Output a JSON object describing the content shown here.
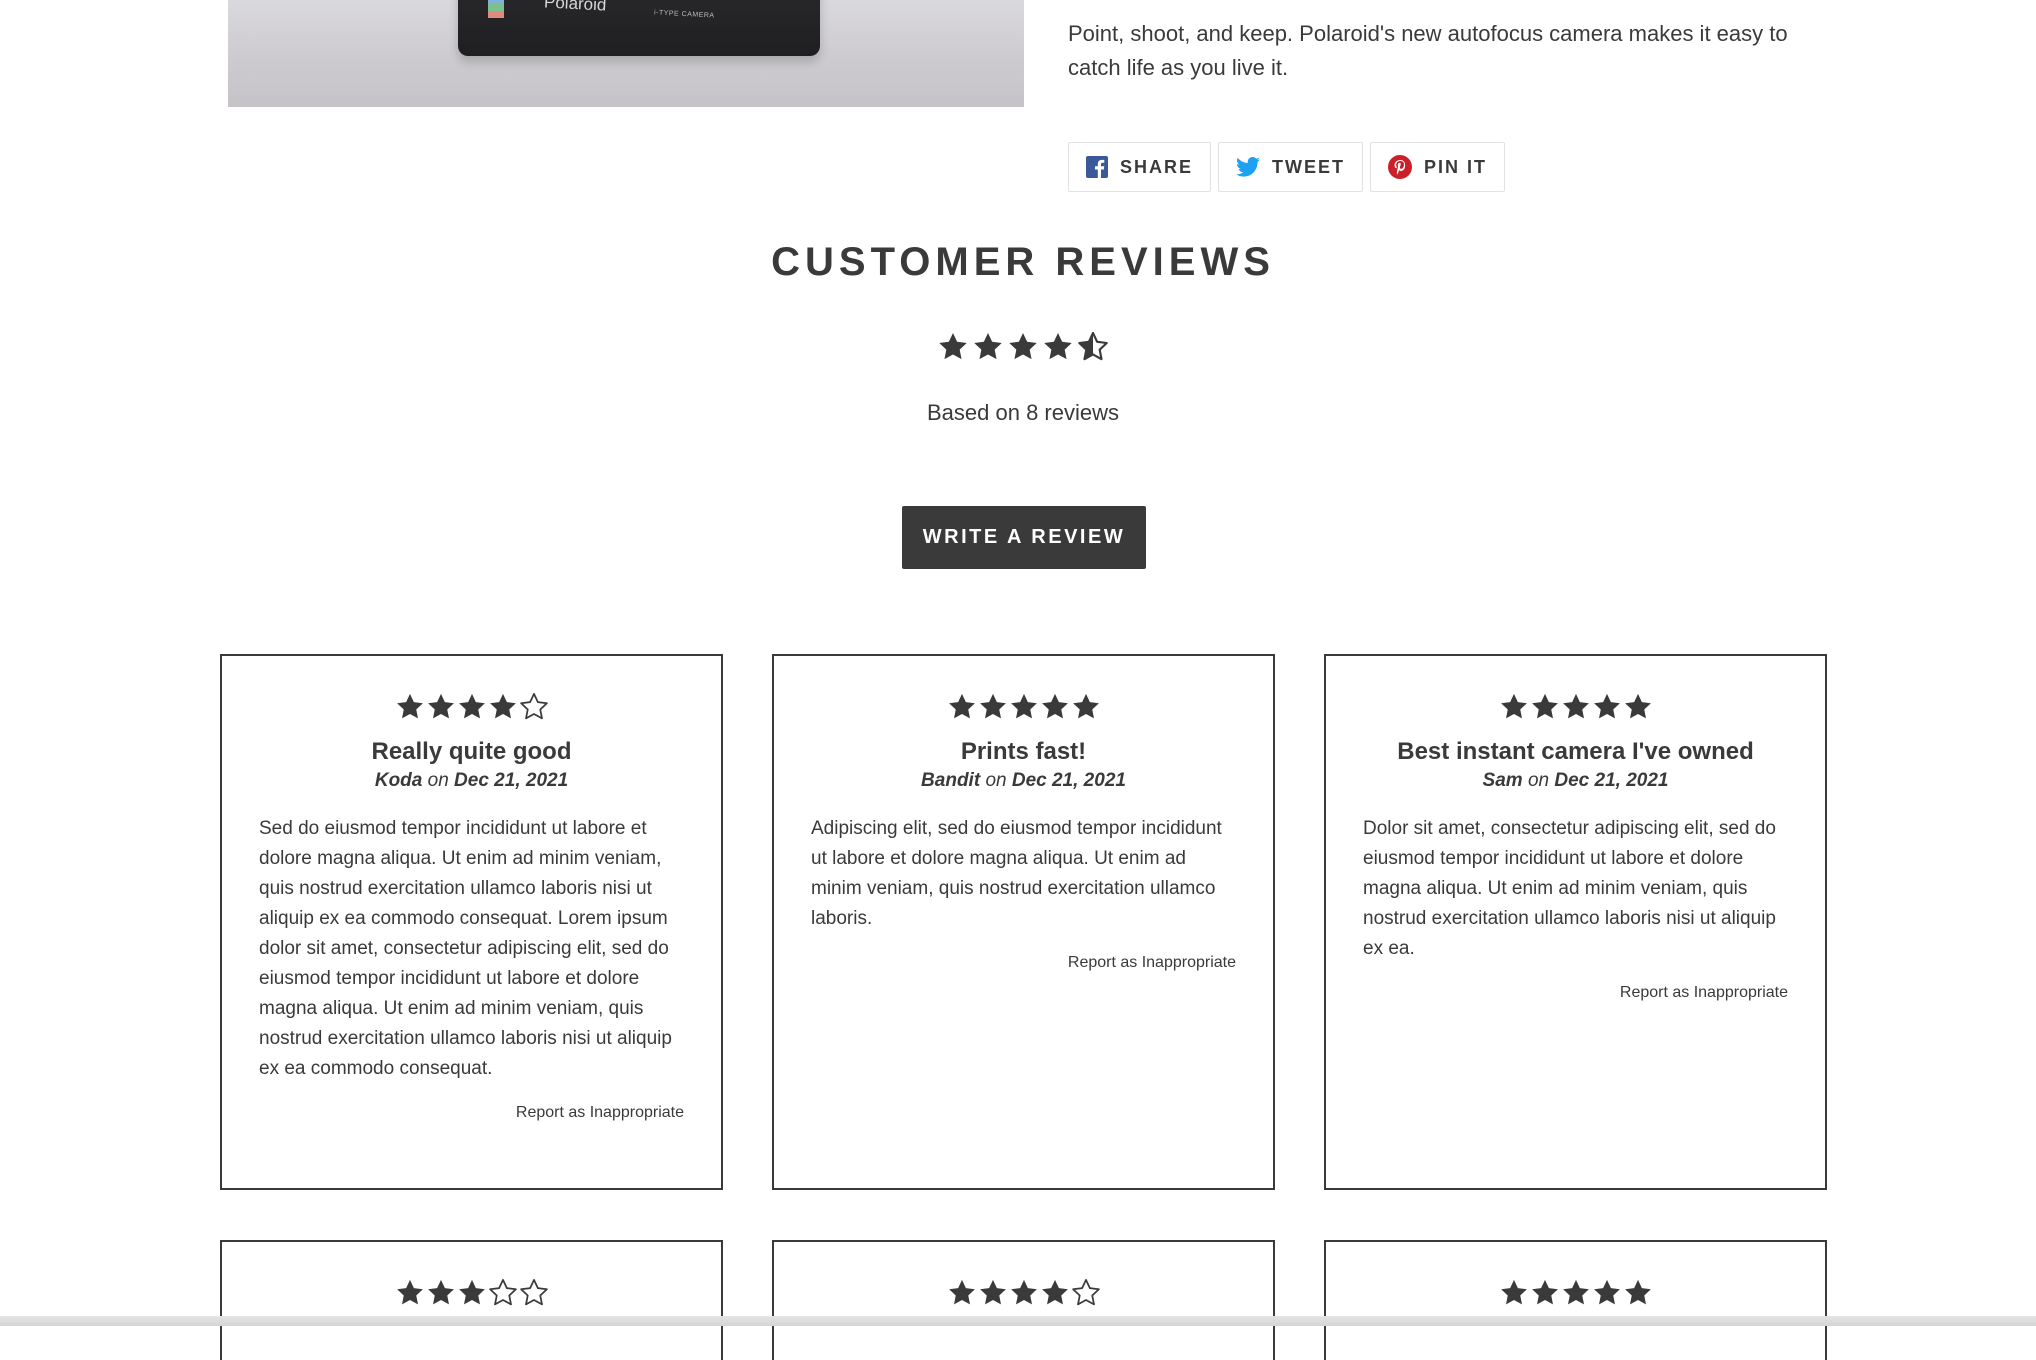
{
  "product": {
    "image_alt": "Polaroid camera",
    "camera_brand_text": "Polaroid",
    "camera_model_text": "i-TYPE CAMERA",
    "description": "Point, shoot, and keep. Polaroid's new autofocus camera makes it easy to catch life as you live it."
  },
  "share": {
    "facebook_label": "SHARE",
    "twitter_label": "TWEET",
    "pinterest_label": "PIN IT",
    "facebook_color": "#3b5998",
    "twitter_color": "#1da1f2",
    "pinterest_color": "#cb2027"
  },
  "reviews_section": {
    "title": "CUSTOMER REVIEWS",
    "average_rating": 4.5,
    "max_rating": 5,
    "summary": "Based on 8 reviews",
    "write_review_label": "WRITE A REVIEW"
  },
  "reviews": [
    {
      "rating": 4,
      "title": "Really quite good",
      "author": "Koda",
      "on": "on",
      "date": "Dec 21, 2021",
      "body": "Sed do eiusmod tempor incididunt ut labore et dolore magna aliqua. Ut enim ad minim veniam, quis nostrud exercitation ullamco laboris nisi ut aliquip ex ea commodo consequat. Lorem ipsum dolor sit amet, consectetur adipiscing elit, sed do eiusmod tempor incididunt ut labore et dolore magna aliqua. Ut enim ad minim veniam, quis nostrud exercitation ullamco laboris nisi ut aliquip ex ea commodo consequat.",
      "report_label": "Report as Inappropriate"
    },
    {
      "rating": 5,
      "title": "Prints fast!",
      "author": "Bandit",
      "on": "on",
      "date": "Dec 21, 2021",
      "body": "Adipiscing elit, sed do eiusmod tempor incididunt ut labore et dolore magna aliqua. Ut enim ad minim veniam, quis nostrud exercitation ullamco laboris.",
      "report_label": "Report as Inappropriate"
    },
    {
      "rating": 5,
      "title": "Best instant camera I've owned",
      "author": "Sam",
      "on": "on",
      "date": "Dec 21, 2021",
      "body": "Dolor sit amet, consectetur adipiscing elit, sed do eiusmod tempor incididunt ut labore et dolore magna aliqua. Ut enim ad minim veniam, quis nostrud exercitation ullamco laboris nisi ut aliquip ex ea.",
      "report_label": "Report as Inappropriate"
    },
    {
      "rating": 3
    },
    {
      "rating": 4
    },
    {
      "rating": 5
    }
  ],
  "colors": {
    "text": "#3a3a3a",
    "button_bg": "#3a3a3a",
    "button_text": "#ffffff",
    "card_border": "#3a3a3a",
    "star_fill": "#3a3a3a"
  }
}
